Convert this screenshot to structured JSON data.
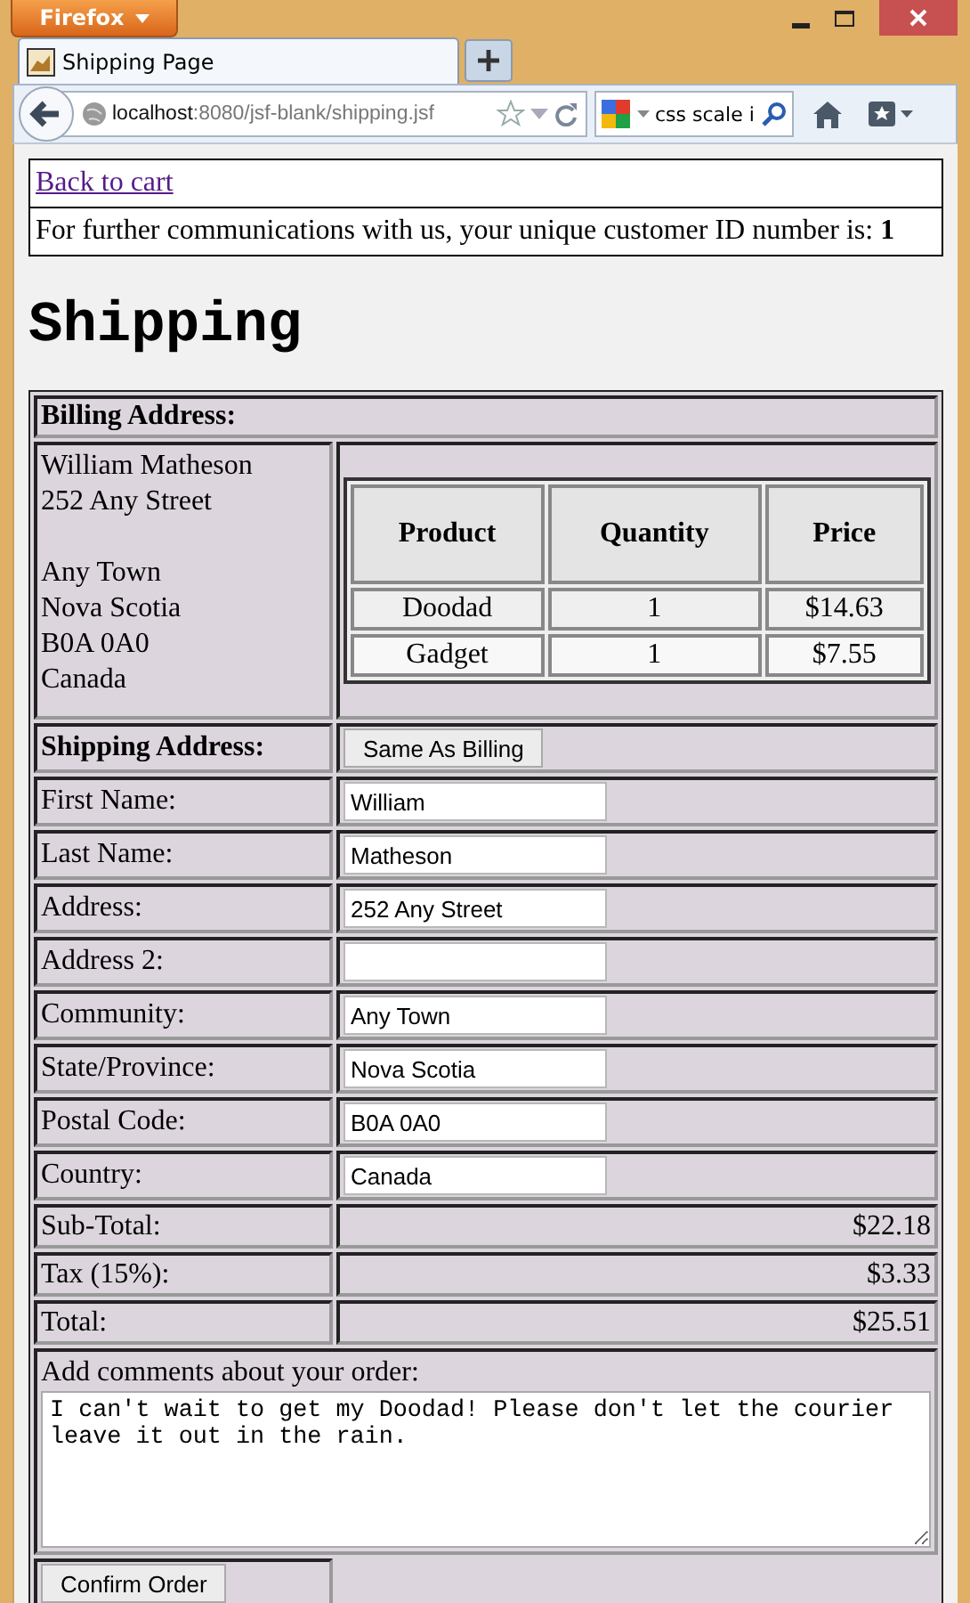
{
  "window": {
    "app_button": "Firefox"
  },
  "tabs": [
    {
      "title": "Shipping Page",
      "selected": true
    }
  ],
  "address_bar": {
    "host": "localhost",
    "path": ":8080/jsf-blank/shipping.jsf"
  },
  "search": {
    "value": "css scale i"
  },
  "page": {
    "back_link": "Back to cart",
    "customer_note": "For further communications with us, your unique customer ID number is: **1**",
    "heading": "Shipping",
    "billing": {
      "heading": "Billing Address:",
      "blocks": [
        [
          "William Matheson",
          "252 Any Street"
        ],
        [
          "Any Town",
          "Nova Scotia",
          "B0A 0A0",
          "Canada"
        ]
      ]
    },
    "order_table": {
      "columns": [
        "Product",
        "Quantity",
        "Price"
      ],
      "rows": [
        [
          "Doodad",
          "1",
          "$14.63"
        ],
        [
          "Gadget",
          "1",
          "$7.55"
        ]
      ]
    },
    "shipping": {
      "heading": "Shipping Address:",
      "copy_button": "Same As Billing",
      "fields": [
        {
          "label": "First Name:",
          "value": "William"
        },
        {
          "label": "Last Name:",
          "value": "Matheson"
        },
        {
          "label": "Address:",
          "value": "252 Any Street"
        },
        {
          "label": "Address 2:"
        },
        {
          "label": "Community:",
          "value": "Any Town"
        },
        {
          "label": "State/Province:",
          "value": "Nova Scotia"
        },
        {
          "label": "Postal Code:",
          "value": "B0A 0A0"
        },
        {
          "label": "Country:",
          "value": "Canada"
        }
      ]
    },
    "totals": [
      {
        "label": "Sub-Total:",
        "value": "$22.18"
      },
      {
        "label": "Tax (15%):",
        "value": "$3.33"
      },
      {
        "label": "Total:",
        "value": "$25.51"
      }
    ],
    "comments": {
      "label": "Add comments about your order:",
      "value": "I can't wait to get my Doodad! Please don't let the courier leave it out in the rain."
    },
    "confirm_button": "Confirm Order"
  }
}
